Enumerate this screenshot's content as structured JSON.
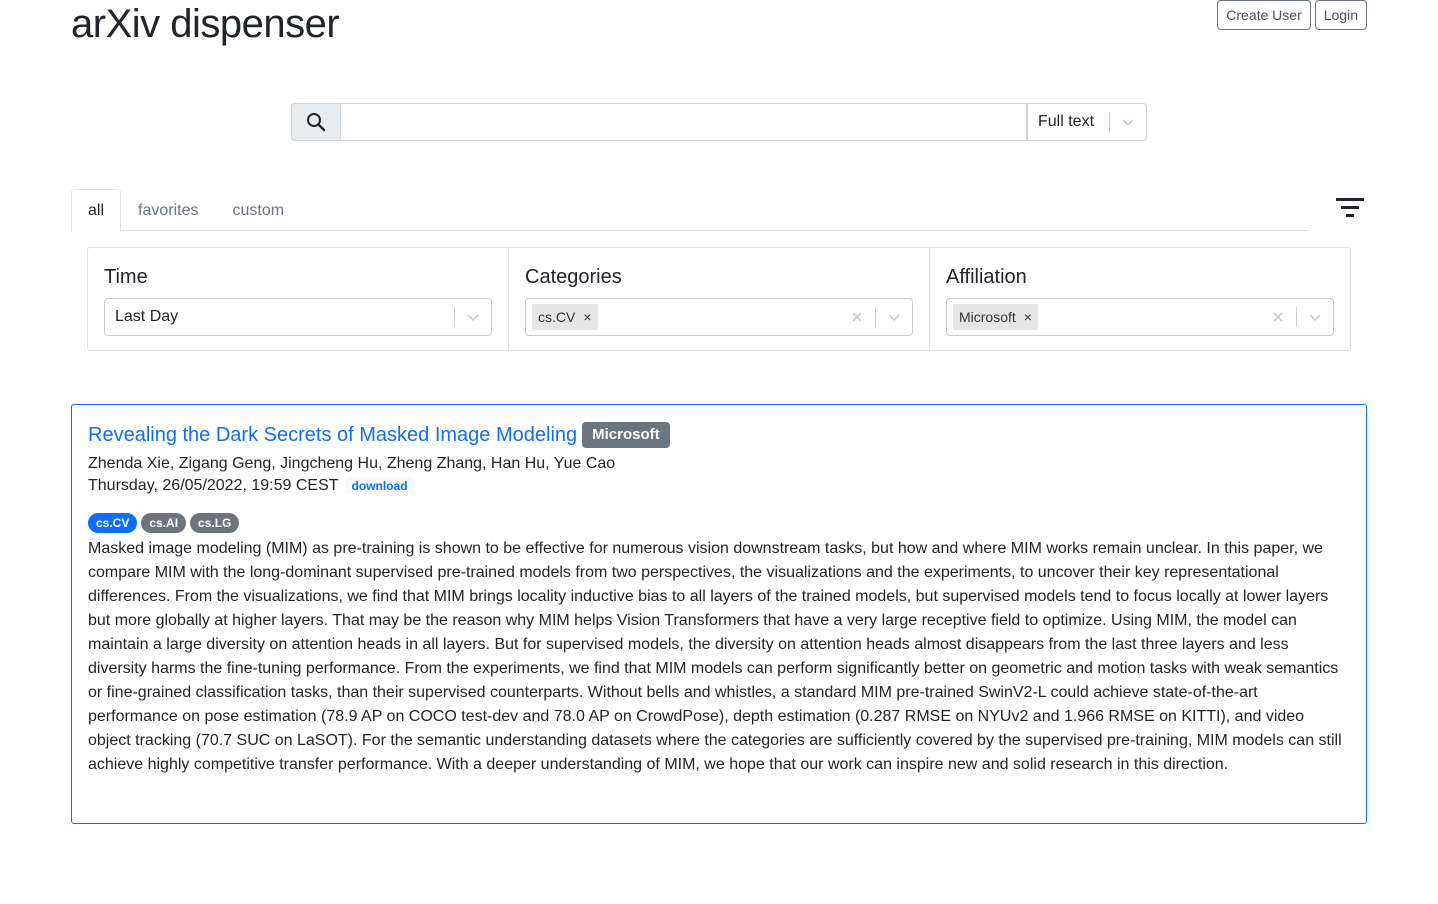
{
  "app": {
    "title": "arXiv dispenser"
  },
  "header": {
    "create_user": "Create User",
    "login": "Login"
  },
  "search": {
    "value": "",
    "placeholder": "",
    "mode": "Full text"
  },
  "tabs": [
    {
      "label": "all",
      "active": true
    },
    {
      "label": "favorites",
      "active": false
    },
    {
      "label": "custom",
      "active": false
    }
  ],
  "filters": {
    "time": {
      "label": "Time",
      "value": "Last Day"
    },
    "categories": {
      "label": "Categories",
      "selected": [
        "cs.CV"
      ]
    },
    "affiliation": {
      "label": "Affiliation",
      "selected": [
        "Microsoft"
      ]
    }
  },
  "paper": {
    "title": "Revealing the Dark Secrets of Masked Image Modeling",
    "affiliation": "Microsoft",
    "authors": "Zhenda Xie, Zigang Geng, Jingcheng Hu, Zheng Zhang, Han Hu, Yue Cao",
    "date": "Thursday, 26/05/2022, 19:59 CEST",
    "download": "download",
    "categories": [
      {
        "label": "cs.CV",
        "color": "#0d6efd"
      },
      {
        "label": "cs.AI",
        "color": "#6c757d"
      },
      {
        "label": "cs.LG",
        "color": "#6c757d"
      }
    ],
    "abstract": "Masked image modeling (MIM) as pre-training is shown to be effective for numerous vision downstream tasks, but how and where MIM works remain unclear. In this paper, we compare MIM with the long-dominant supervised pre-trained models from two perspectives, the visualizations and the experiments, to uncover their key representational differences. From the visualizations, we find that MIM brings locality inductive bias to all layers of the trained models, but supervised models tend to focus locally at lower layers but more globally at higher layers. That may be the reason why MIM helps Vision Transformers that have a very large receptive field to optimize. Using MIM, the model can maintain a large diversity on attention heads in all layers. But for supervised models, the diversity on attention heads almost disappears from the last three layers and less diversity harms the fine-tuning performance. From the experiments, we find that MIM models can perform significantly better on geometric and motion tasks with weak semantics or fine-grained classification tasks, than their supervised counterparts. Without bells and whistles, a standard MIM pre-trained SwinV2-L could achieve state-of-the-art performance on pose estimation (78.9 AP on COCO test-dev and 78.0 AP on CrowdPose), depth estimation (0.287 RMSE on NYUv2 and 1.966 RMSE on KITTI), and video object tracking (70.7 SUC on LaSOT). For the semantic understanding datasets where the categories are sufficiently covered by the supervised pre-training, MIM models can still achieve highly competitive transfer performance. With a deeper understanding of MIM, we hope that our work can inspire new and solid research in this direction."
  },
  "icons": {
    "search": "search-icon",
    "filter": "filter-lines-icon",
    "chevron": "chevron-down-icon",
    "clear": "close-icon"
  },
  "colors": {
    "accent": "#0d6efd",
    "badge_gray": "#6c757d"
  }
}
